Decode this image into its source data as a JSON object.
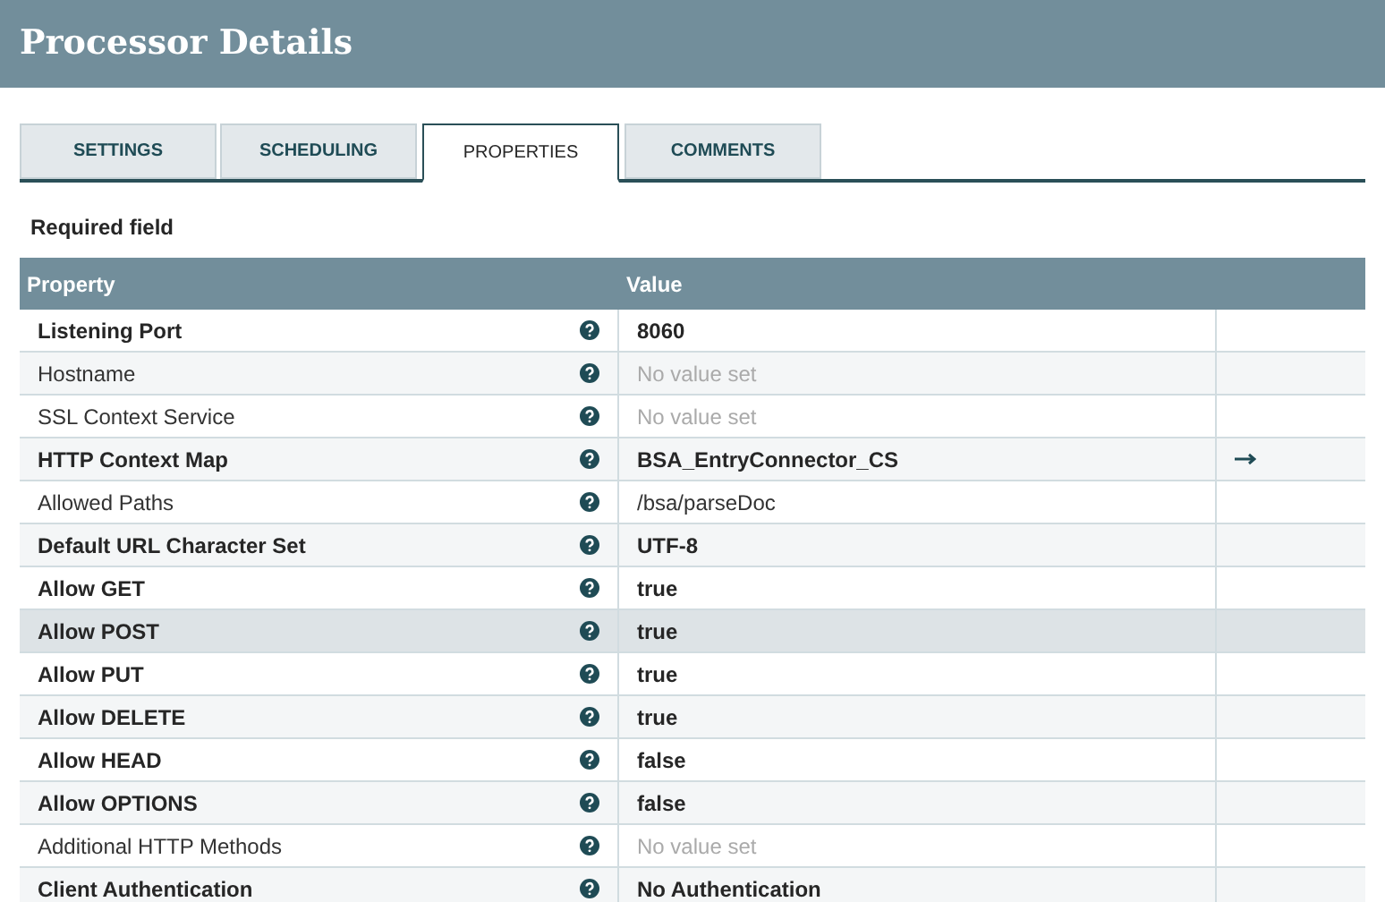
{
  "window": {
    "title": "Processor Details"
  },
  "tabs": [
    {
      "label": "SETTINGS",
      "selected": false
    },
    {
      "label": "SCHEDULING",
      "selected": false
    },
    {
      "label": "PROPERTIES",
      "selected": true
    },
    {
      "label": "COMMENTS",
      "selected": false
    }
  ],
  "required_note": "Required field",
  "table": {
    "columns": [
      "Property",
      "Value"
    ],
    "rows": [
      {
        "name": "Listening Port",
        "required": true,
        "value": "8060",
        "value_set": true,
        "link": false,
        "selected": false
      },
      {
        "name": "Hostname",
        "required": false,
        "value": "No value set",
        "value_set": false,
        "link": false,
        "selected": false
      },
      {
        "name": "SSL Context Service",
        "required": false,
        "value": "No value set",
        "value_set": false,
        "link": false,
        "selected": false
      },
      {
        "name": "HTTP Context Map",
        "required": true,
        "value": "BSA_EntryConnector_CS",
        "value_set": true,
        "link": true,
        "selected": false
      },
      {
        "name": "Allowed Paths",
        "required": false,
        "value": "/bsa/parseDoc",
        "value_set": true,
        "link": false,
        "selected": false
      },
      {
        "name": "Default URL Character Set",
        "required": true,
        "value": "UTF-8",
        "value_set": true,
        "link": false,
        "selected": false
      },
      {
        "name": "Allow GET",
        "required": true,
        "value": "true",
        "value_set": true,
        "link": false,
        "selected": false
      },
      {
        "name": "Allow POST",
        "required": true,
        "value": "true",
        "value_set": true,
        "link": false,
        "selected": true
      },
      {
        "name": "Allow PUT",
        "required": true,
        "value": "true",
        "value_set": true,
        "link": false,
        "selected": false
      },
      {
        "name": "Allow DELETE",
        "required": true,
        "value": "true",
        "value_set": true,
        "link": false,
        "selected": false
      },
      {
        "name": "Allow HEAD",
        "required": true,
        "value": "false",
        "value_set": true,
        "link": false,
        "selected": false
      },
      {
        "name": "Allow OPTIONS",
        "required": true,
        "value": "false",
        "value_set": true,
        "link": false,
        "selected": false
      },
      {
        "name": "Additional HTTP Methods",
        "required": false,
        "value": "No value set",
        "value_set": false,
        "link": false,
        "selected": false
      },
      {
        "name": "Client Authentication",
        "required": true,
        "value": "No Authentication",
        "value_set": true,
        "link": false,
        "selected": false
      }
    ]
  }
}
